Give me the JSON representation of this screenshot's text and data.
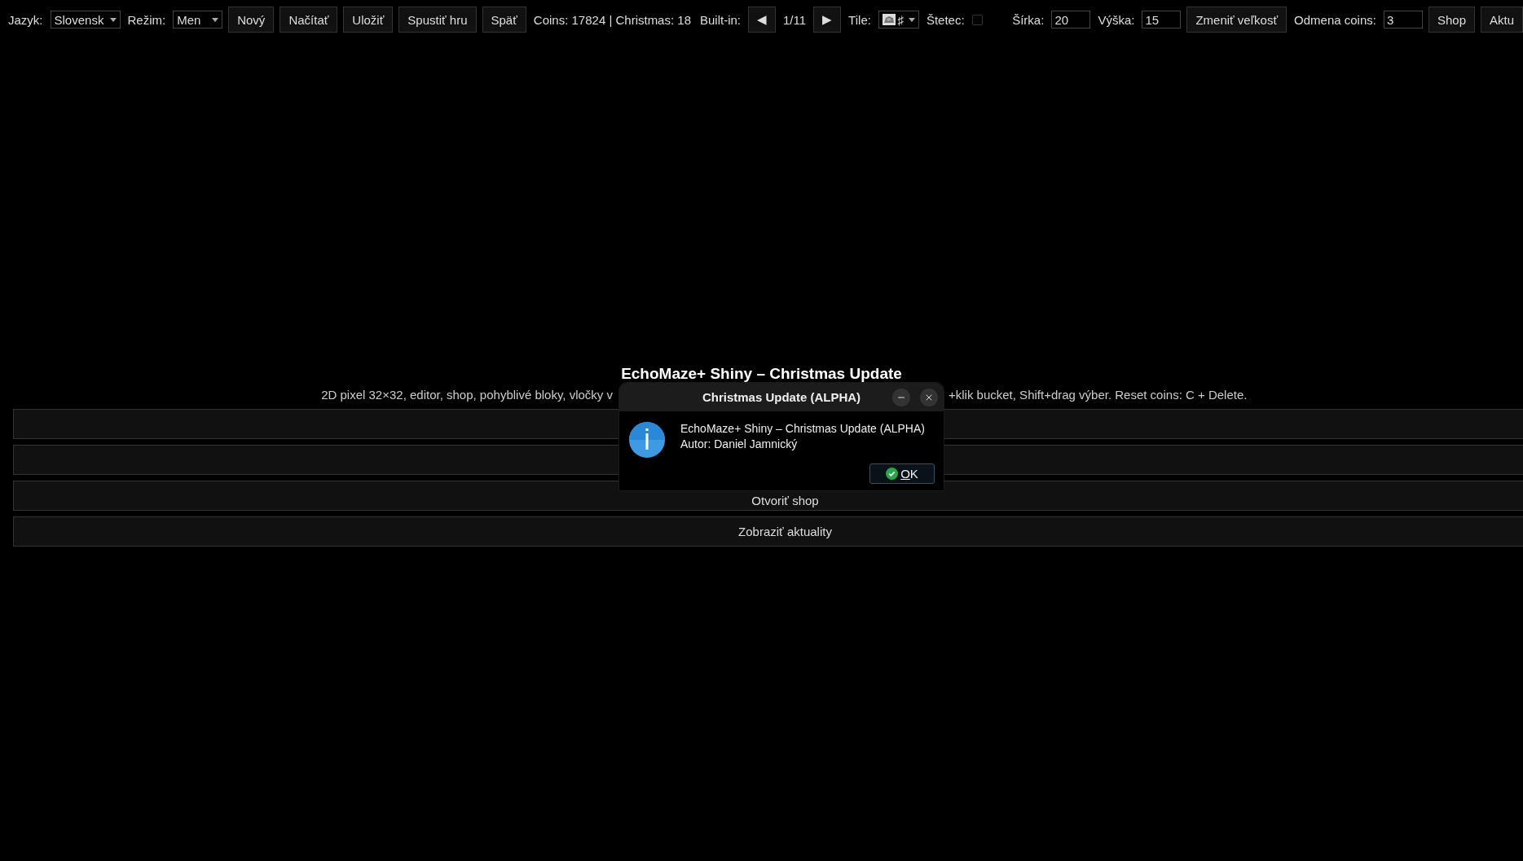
{
  "toolbar": {
    "left": [
      {
        "kind": "label",
        "text": "Jazyk:"
      },
      {
        "kind": "select",
        "value": "Slovensk"
      },
      {
        "kind": "label",
        "text": "Režim:"
      },
      {
        "kind": "select",
        "value": "Men"
      },
      {
        "kind": "button",
        "text": "Nový"
      },
      {
        "kind": "button",
        "text": "Načítať"
      },
      {
        "kind": "button",
        "text": "Uložiť"
      },
      {
        "kind": "button",
        "text": "Spustiť hru"
      },
      {
        "kind": "button",
        "text": "Späť"
      },
      {
        "kind": "label",
        "text": "Coins: 17824 | Christmas: 18"
      },
      {
        "kind": "label",
        "text": "Built-in:"
      },
      {
        "kind": "button",
        "text": "◀"
      },
      {
        "kind": "label",
        "text": "1/11"
      },
      {
        "kind": "button",
        "text": "▶"
      },
      {
        "kind": "label",
        "text": "Tile:"
      },
      {
        "kind": "tile_select",
        "value": "♯"
      },
      {
        "kind": "label",
        "text": "Štetec:"
      },
      {
        "kind": "checkbox",
        "checked": false
      }
    ],
    "right": [
      {
        "kind": "label",
        "text": "Šírka:"
      },
      {
        "kind": "input",
        "value": "20"
      },
      {
        "kind": "label",
        "text": "Výška:"
      },
      {
        "kind": "input",
        "value": "15"
      },
      {
        "kind": "button",
        "text": "Zmeniť veľkosť"
      },
      {
        "kind": "label",
        "text": "Odmena coins:"
      },
      {
        "kind": "input",
        "value": "3"
      },
      {
        "kind": "button",
        "text": "Shop"
      },
      {
        "kind": "button",
        "text": "Aktu"
      }
    ]
  },
  "menu": {
    "title": "EchoMaze+ Shiny – Christmas Update",
    "subtitle_left": "2D pixel 32×32, editor, shop, pohyblivé bloky, vločky v",
    "subtitle_right": "+klik bucket, Shift+drag výber. Reset coins: C + Delete.",
    "buttons": [
      {
        "kind": "blank"
      },
      {
        "kind": "blank"
      },
      {
        "kind": "labeled",
        "label": "Otvoriť shop"
      },
      {
        "kind": "labeled",
        "label": "Zobraziť aktuality"
      }
    ]
  },
  "dialog": {
    "title": "Christmas Update (ALPHA)",
    "lines": [
      "EchoMaze+ Shiny – Christmas Update (ALPHA)",
      "Autor: Daniel Jamnický"
    ],
    "button": "OK"
  }
}
